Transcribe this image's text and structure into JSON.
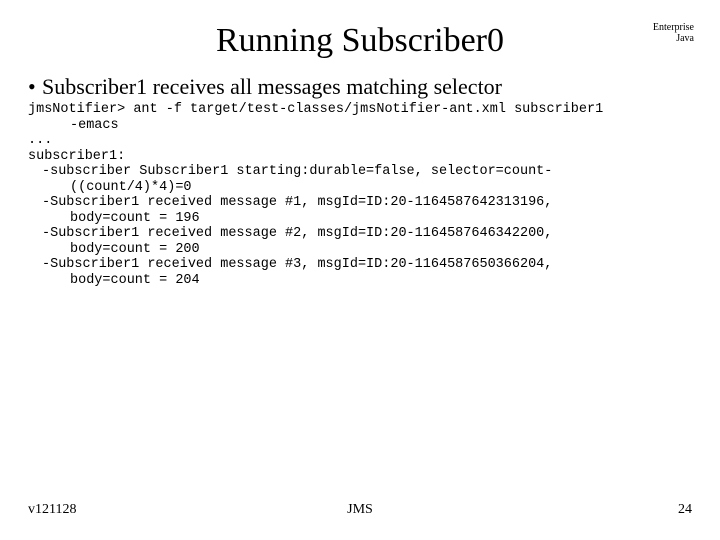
{
  "header": {
    "title": "Running Subscriber0",
    "corner_line1": "Enterprise",
    "corner_line2": "Java"
  },
  "bullet": {
    "dot": "•",
    "text": "Subscriber1 receives all messages matching selector"
  },
  "code": {
    "l01": "jmsNotifier> ant -f target/test-classes/jmsNotifier-ant.xml subscriber1",
    "l02": "-emacs",
    "l03": "...",
    "l04": "subscriber1:",
    "l05": "-subscriber Subscriber1 starting:durable=false, selector=count-",
    "l06": "((count/4)*4)=0",
    "l07": "-Subscriber1 received message #1, msgId=ID:20-1164587642313196,",
    "l08": "body=count = 196",
    "l09": "-Subscriber1 received message #2, msgId=ID:20-1164587646342200,",
    "l10": "body=count = 200",
    "l11": "-Subscriber1 received message #3, msgId=ID:20-1164587650366204,",
    "l12": "body=count = 204"
  },
  "footer": {
    "left": "v121128",
    "center": "JMS",
    "right": "24"
  }
}
